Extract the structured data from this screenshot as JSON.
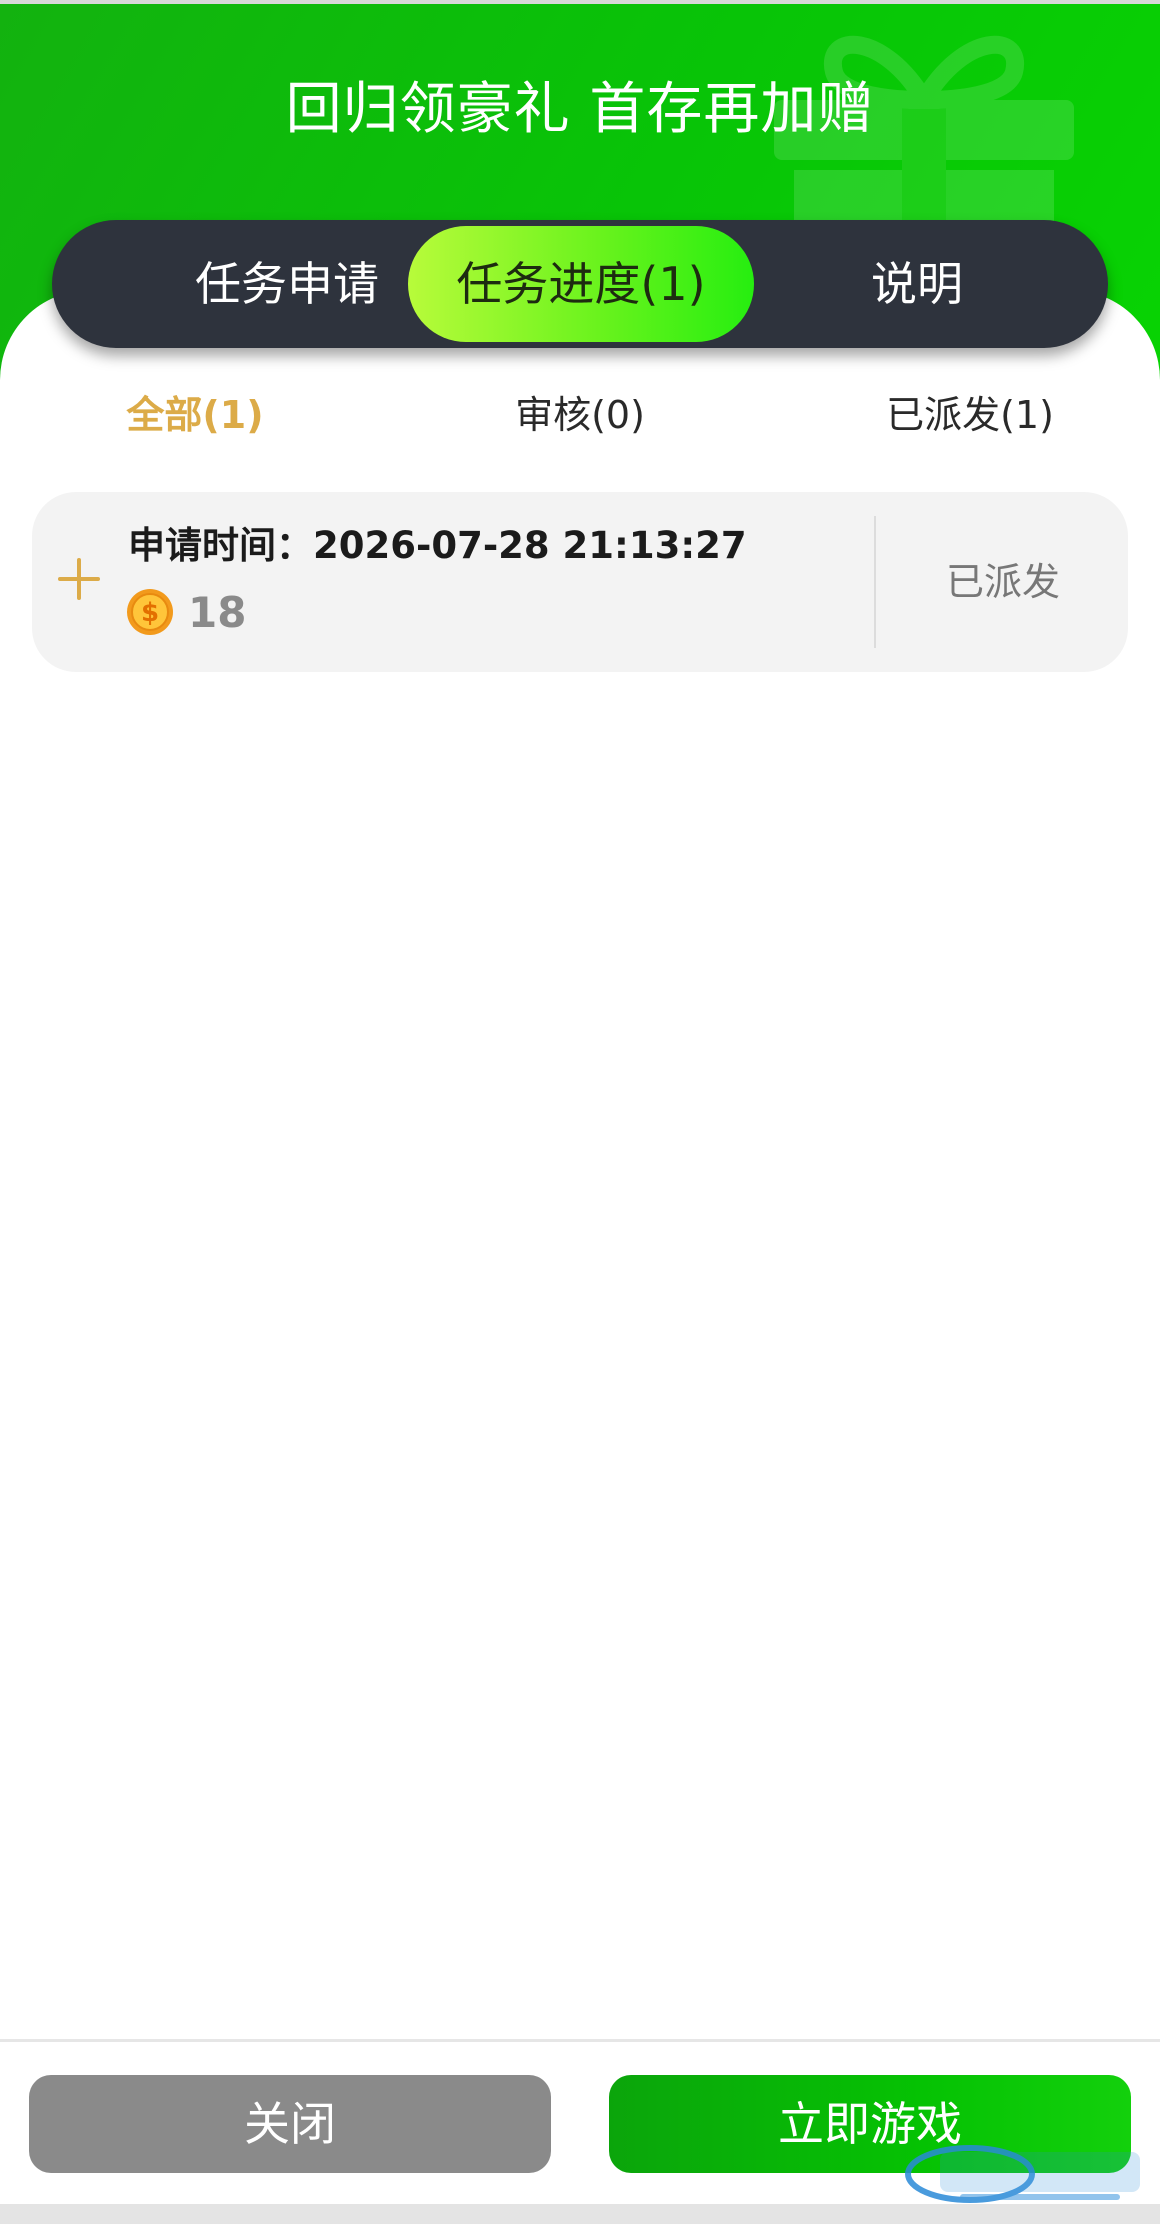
{
  "header": {
    "title": "回归领豪礼 首存再加赠"
  },
  "tabs": [
    {
      "label": "任务申请",
      "active": false
    },
    {
      "label": "任务进度(1)",
      "active": true
    },
    {
      "label": "说明",
      "active": false
    }
  ],
  "filters": [
    {
      "label": "全部(1)",
      "active": true
    },
    {
      "label": "审核(0)",
      "active": false
    },
    {
      "label": "已派发(1)",
      "active": false
    }
  ],
  "records": [
    {
      "time_text": "申请时间：2026-07-28 21:13:27",
      "coin_amount": "18",
      "status": "已派发"
    }
  ],
  "footer": {
    "close_label": "关闭",
    "play_label": "立即游戏"
  },
  "colors": {
    "header_green": "#08c407",
    "tab_bar_dark": "#2e333d",
    "active_tab_green": "#6af31d",
    "accent_gold": "#dcab48",
    "close_gray": "#8a8a8a",
    "play_green": "#05c203"
  },
  "icons": {
    "gift": "gift-icon",
    "expand": "plus-icon",
    "coin": "coin-icon"
  }
}
